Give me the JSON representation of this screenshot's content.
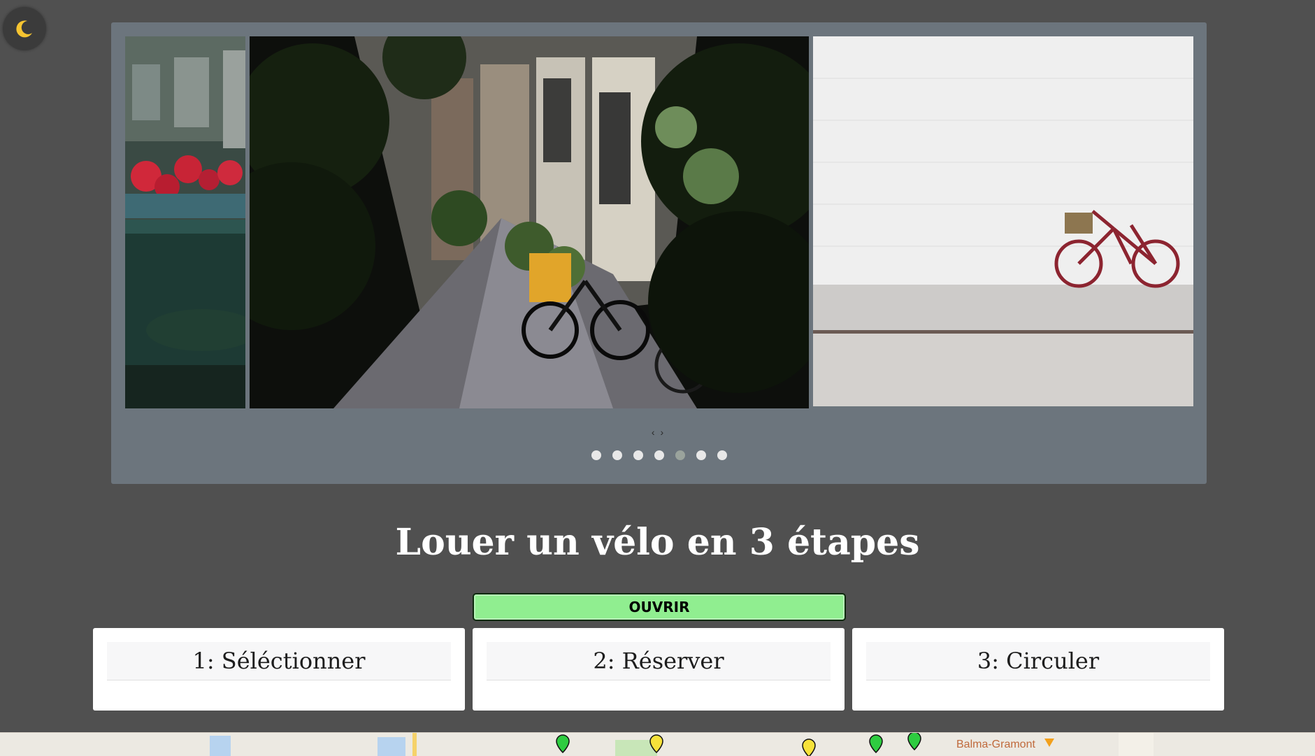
{
  "theme_toggle": {
    "icon": "moon-icon",
    "icon_color": "#f5c431"
  },
  "carousel": {
    "prev_label": "‹",
    "next_label": "›",
    "slides": [
      {
        "subject": "flowers-and-bike-saddle"
      },
      {
        "subject": "alley-with-bicycles"
      },
      {
        "subject": "red-bicycle-white-wall"
      }
    ],
    "dot_count": 7,
    "active_dot": 5
  },
  "section": {
    "title": "Louer un vélo en 3 étapes"
  },
  "open_button": {
    "label": "OUVRIR",
    "color": "#90ee90"
  },
  "steps": [
    {
      "label": "1: Séléctionner"
    },
    {
      "label": "2: Réserver"
    },
    {
      "label": "3: Circuler"
    }
  ],
  "map": {
    "place_label": "Balma-Gramont"
  },
  "colors": {
    "background": "#505050",
    "carousel_bg": "#6c757d",
    "card_bg": "#ffffff"
  }
}
